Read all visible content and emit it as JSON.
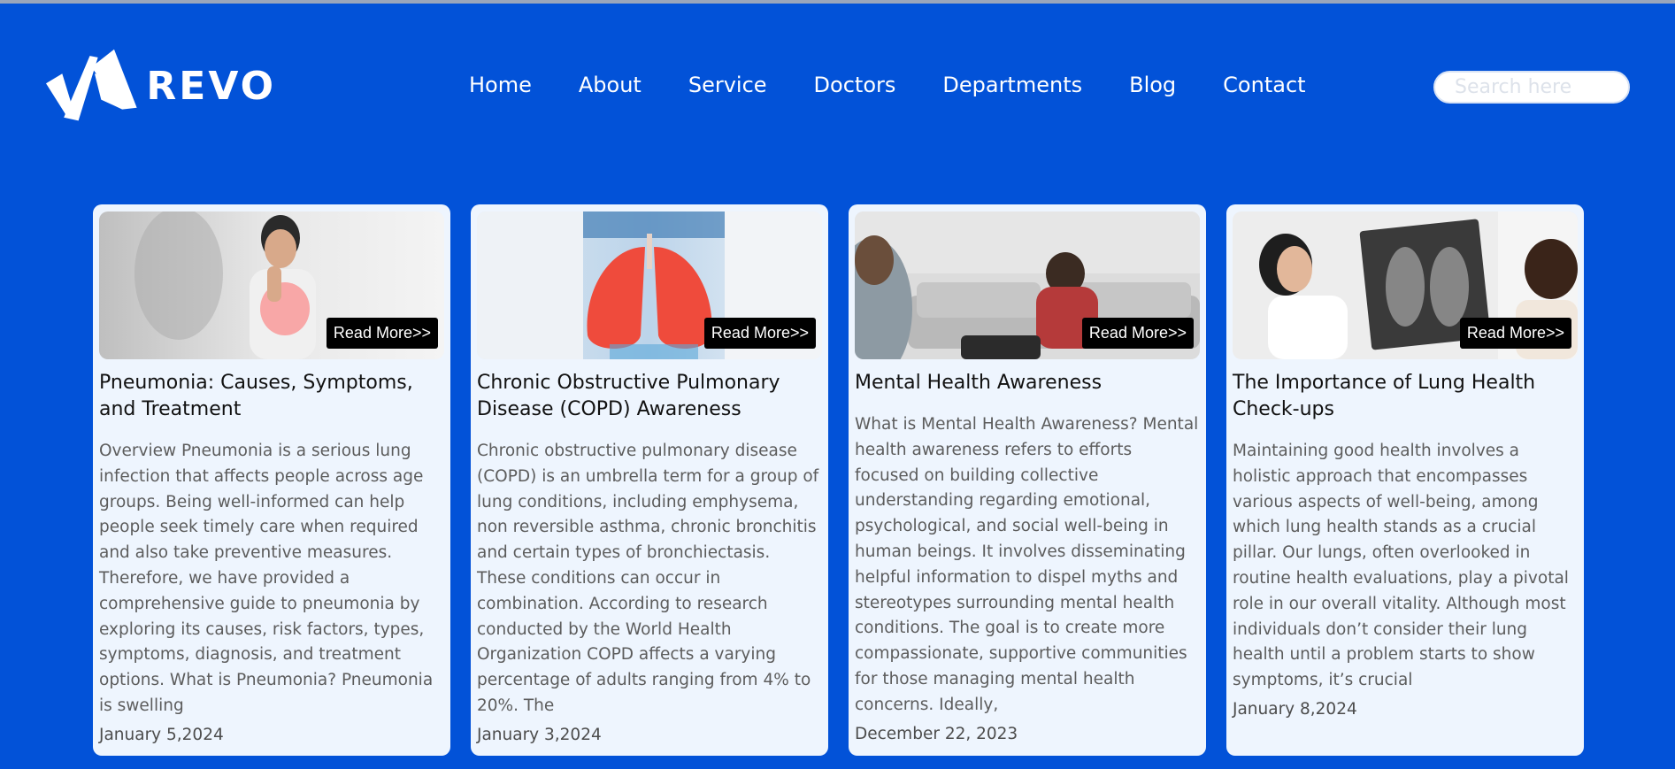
{
  "brand": {
    "name": "REVO",
    "logo_icon": "revo-logo-mark"
  },
  "nav": {
    "items": [
      {
        "label": "Home"
      },
      {
        "label": "About"
      },
      {
        "label": "Service"
      },
      {
        "label": "Doctors"
      },
      {
        "label": "Departments"
      },
      {
        "label": "Blog"
      },
      {
        "label": "Contact"
      }
    ]
  },
  "search": {
    "placeholder": "Search here",
    "value": ""
  },
  "colors": {
    "background": "#0252d8",
    "card": "#eef5fe",
    "button": "#000000"
  },
  "posts": [
    {
      "title": "Pneumonia: Causes, Symptoms, and Treatment",
      "excerpt": "Overview Pneumonia is a serious lung infection that affects people across age groups. Being well-informed can help people seek timely care when required and also take preventive measures. Therefore, we have provided a comprehensive guide to pneumonia by exploring its causes, risk factors, types, symptoms, diagnosis, and treatment options. What is Pneumonia? Pneumonia is swelling",
      "date": "January 5,2024",
      "read_more": "Read More>>",
      "image": "man-coughing-photo"
    },
    {
      "title": "Chronic Obstructive Pulmonary Disease (COPD) Awareness",
      "excerpt": "Chronic obstructive pulmonary disease (COPD) is an umbrella term for a group of lung conditions, including emphysema, non reversible asthma, chronic bronchitis and certain types of bronchiectasis. These conditions can occur in combination. According to research conducted by the World Health Organization COPD affects a varying percentage of adults ranging from 4% to 20%. The",
      "date": "January 3,2024",
      "read_more": "Read More>>",
      "image": "lungs-hologram-photo"
    },
    {
      "title": "Mental Health Awareness",
      "excerpt": "What is Mental Health Awareness? Mental health awareness refers to efforts focused on building collective understanding regarding emotional, psychological, and social well-being in human beings. It involves disseminating helpful information to dispel myths and stereotypes surrounding mental health conditions. The goal is to create more compassionate, supportive communities for those managing mental health concerns. Ideally,",
      "date": "December 22, 2023",
      "read_more": "Read More>>",
      "image": "therapy-session-photo"
    },
    {
      "title": "The Importance of Lung Health Check-ups",
      "excerpt": "Maintaining good health involves a holistic approach that encompasses various aspects of well-being, among which lung health stands as a crucial pillar. Our lungs, often overlooked in routine health evaluations, play a pivotal role in our overall vitality. Although most individuals don’t consider their lung health until a problem starts to show symptoms, it’s crucial",
      "date": "January 8,2024",
      "read_more": "Read More>>",
      "image": "doctor-xray-photo"
    }
  ]
}
